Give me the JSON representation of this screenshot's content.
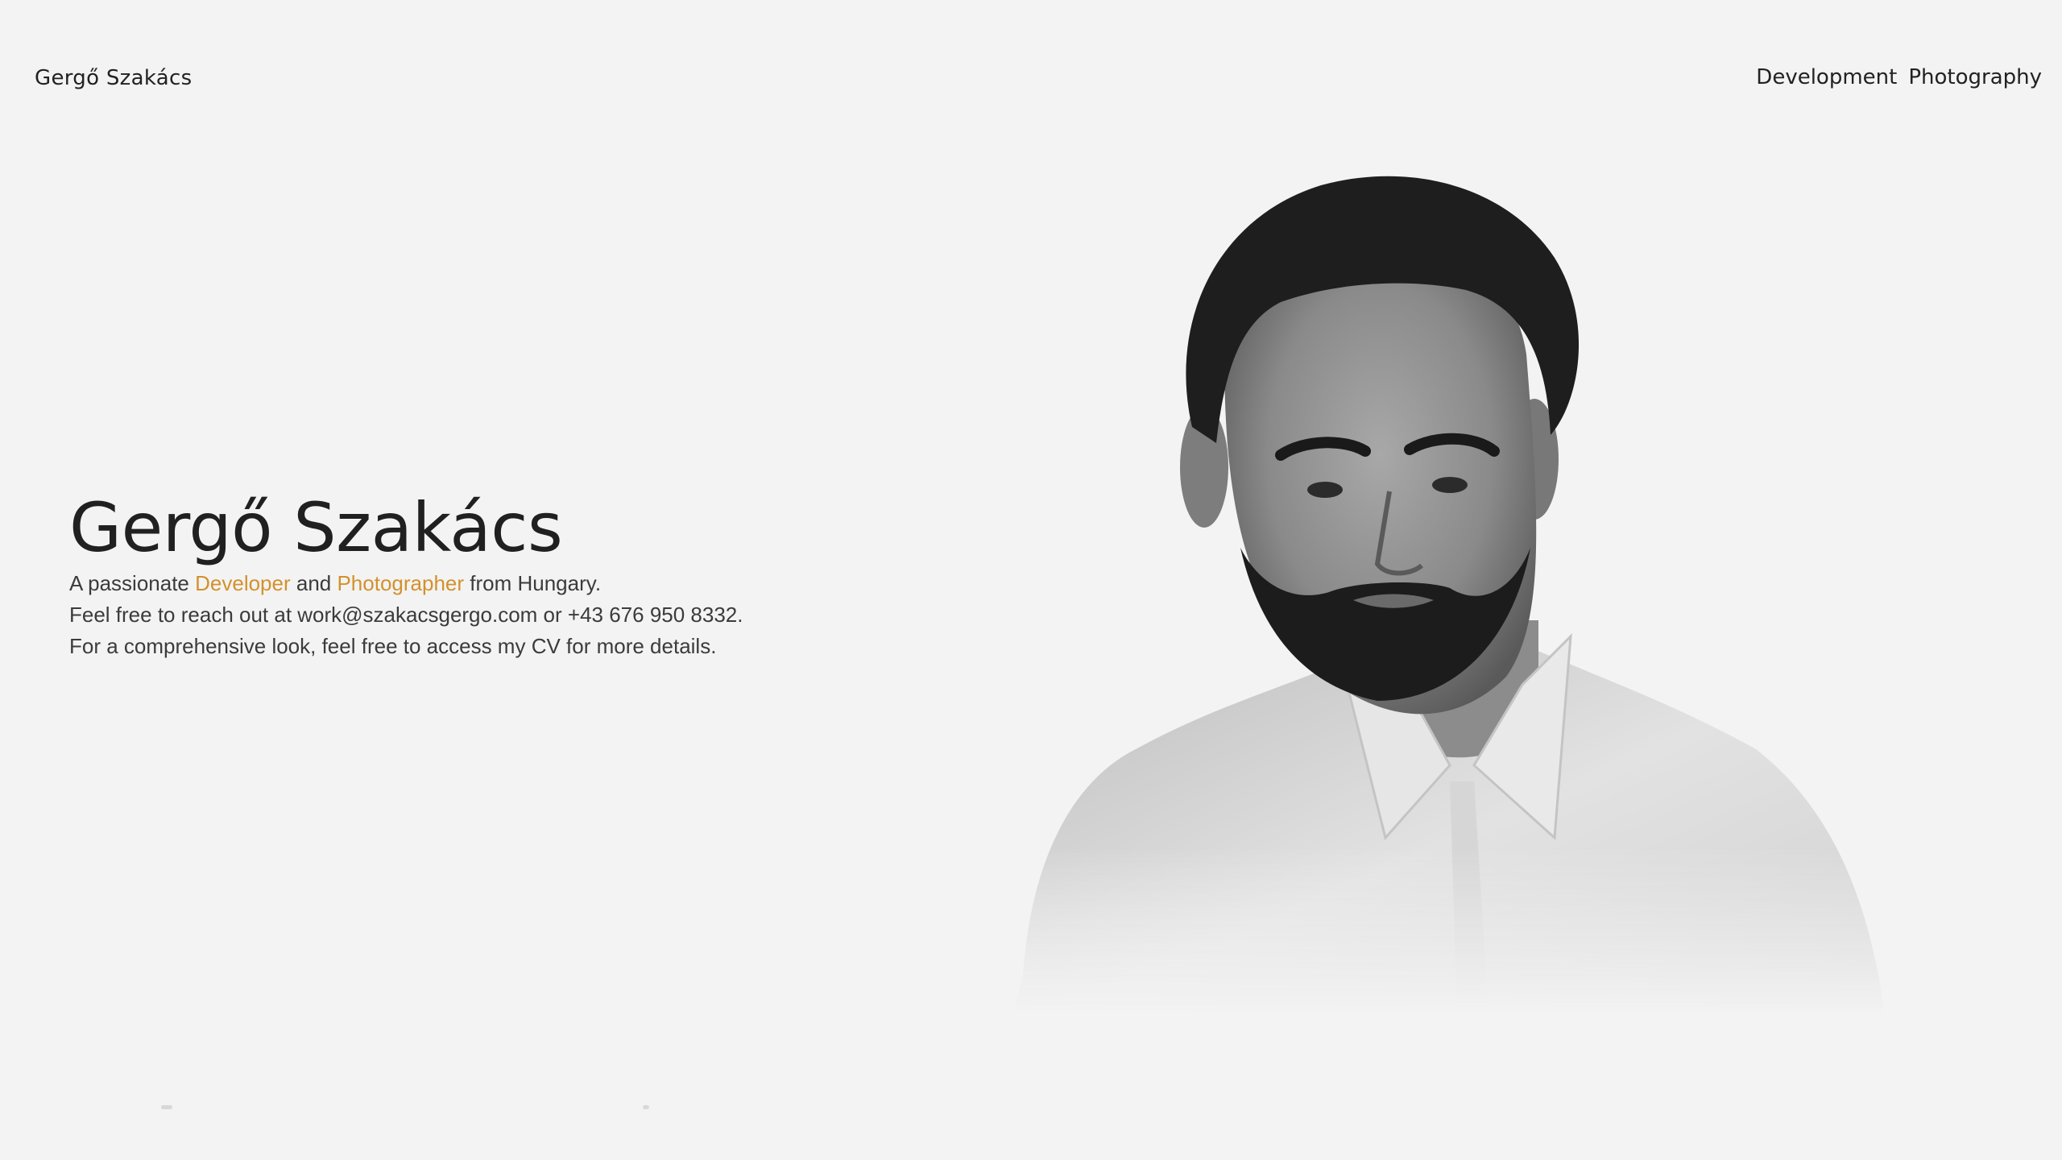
{
  "header": {
    "site_name": "Gergő Szakács",
    "nav": [
      {
        "label": "Development"
      },
      {
        "label": "Photography"
      }
    ]
  },
  "hero": {
    "title": "Gergő Szakács",
    "line1": {
      "prefix": "A passionate ",
      "developer": "Developer",
      "middle": " and ",
      "photographer": "Photographer",
      "suffix": " from Hungary."
    },
    "line2": "Feel free to reach out at work@szakacsgergo.com or +43 676 950 8332.",
    "line3": "For a comprehensive look, feel free to access my CV for more details."
  },
  "colors": {
    "background": "#f3f3f3",
    "accent": "#d3912c",
    "text": "#2a2a2a"
  }
}
